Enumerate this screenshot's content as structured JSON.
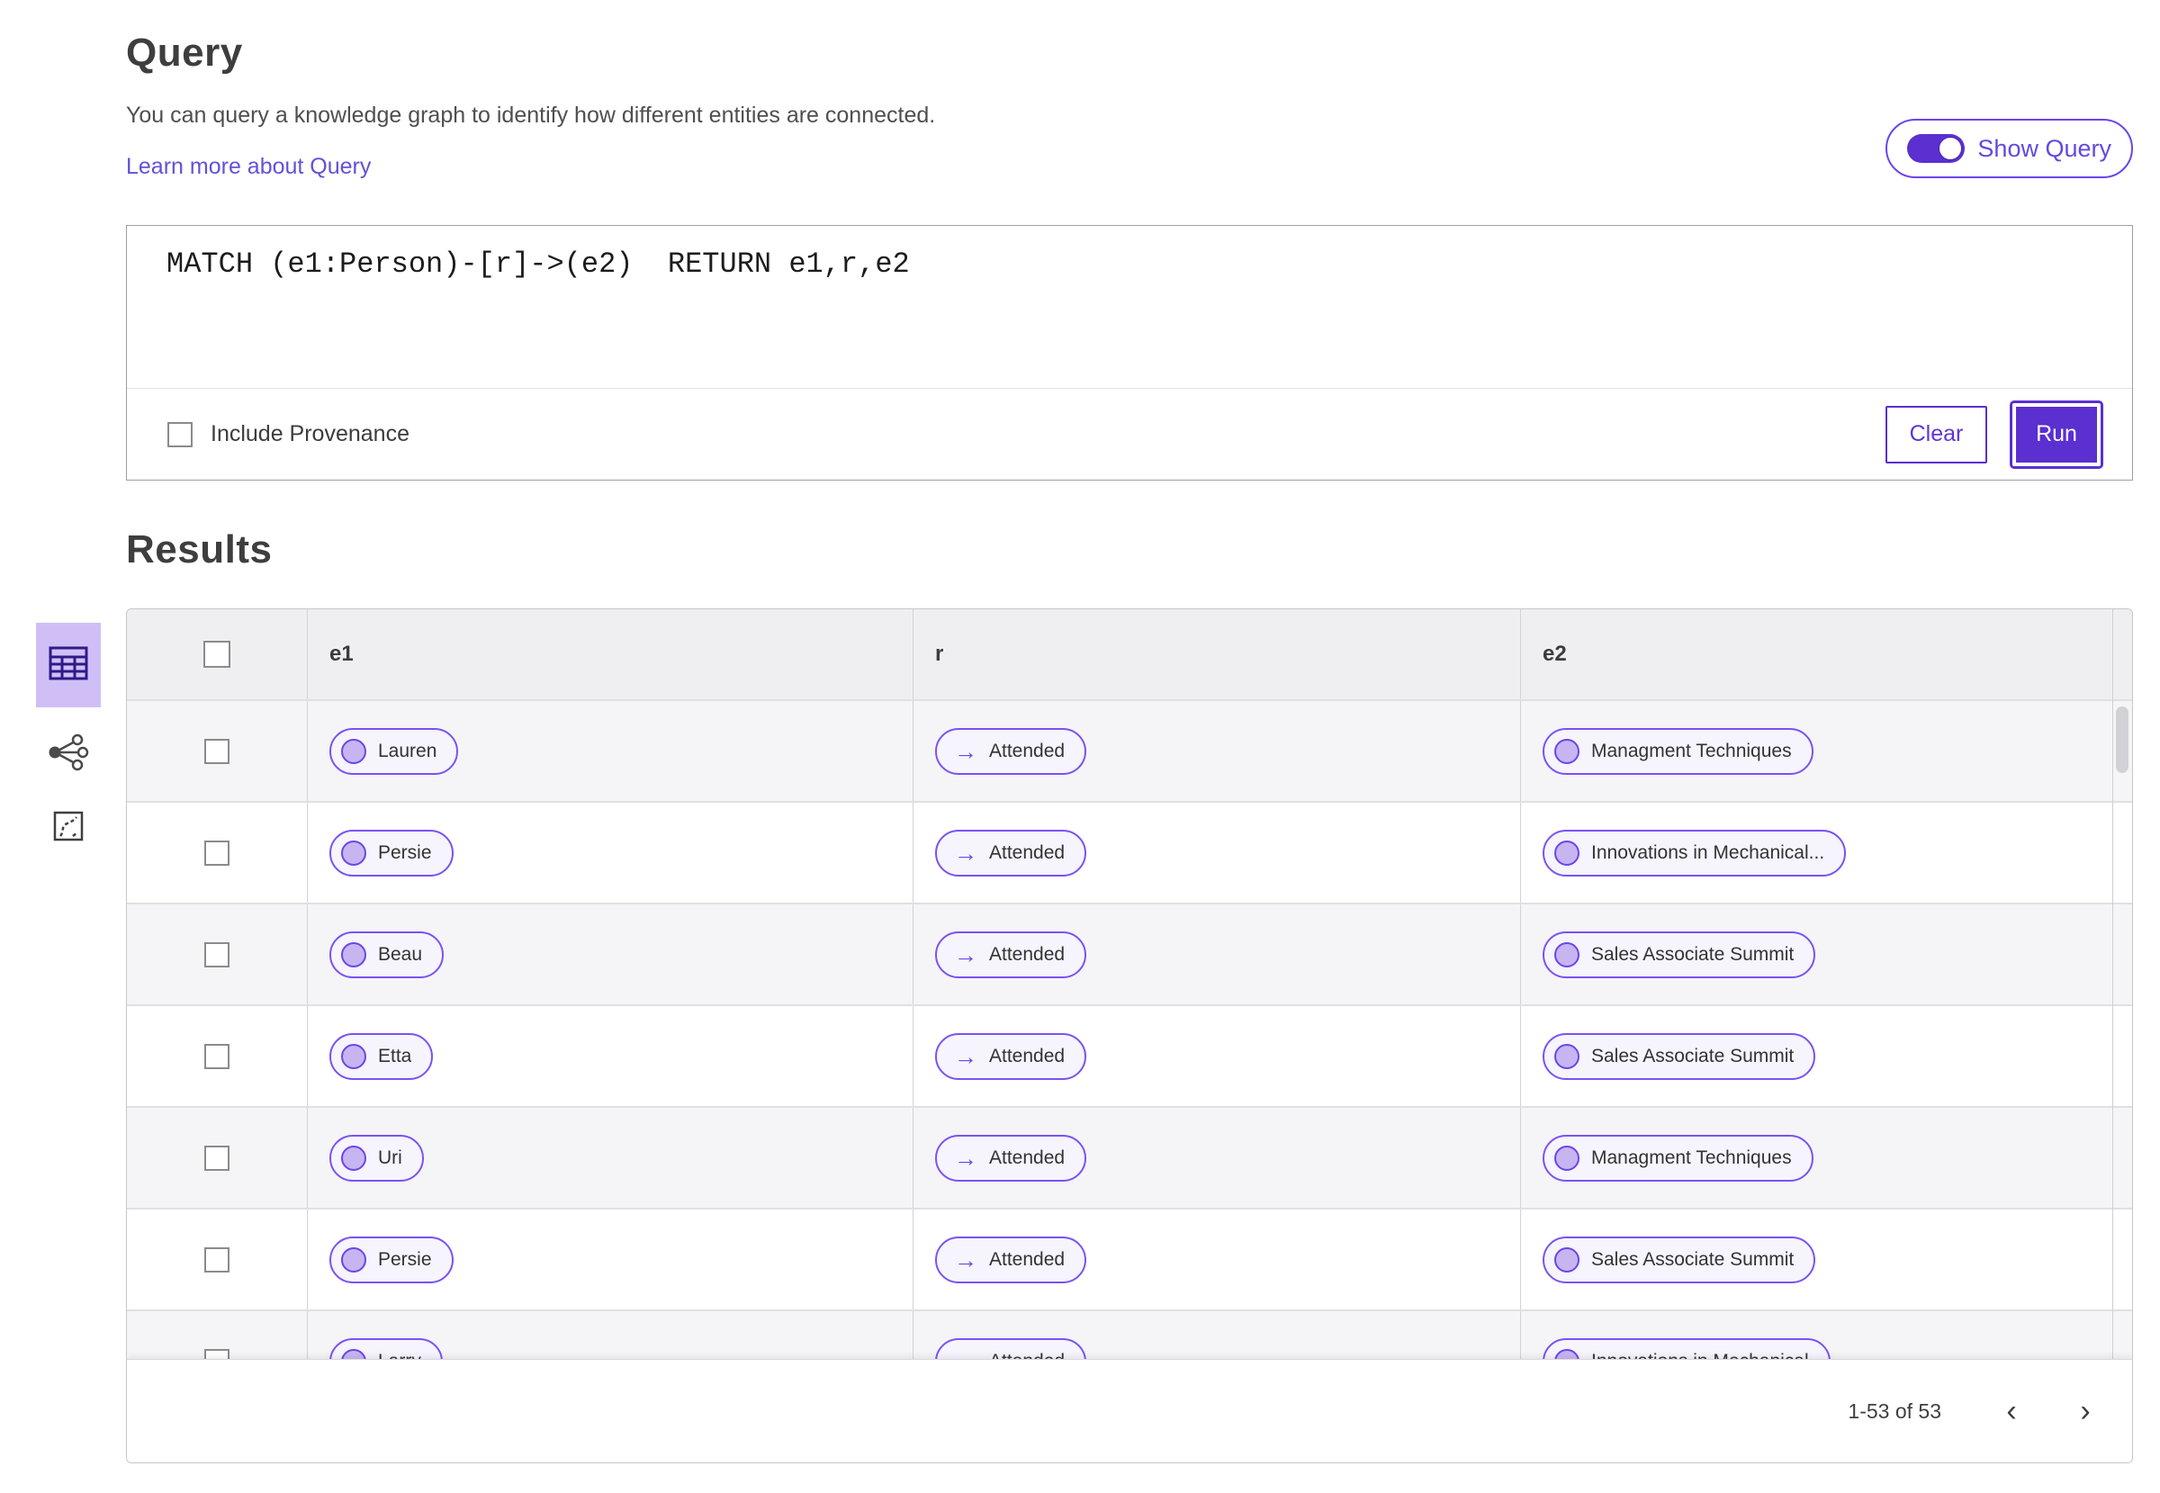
{
  "header": {
    "title": "Query",
    "description": "You can query a knowledge graph to identify how different entities are connected.",
    "learn_more": "Learn more about Query",
    "show_query_label": "Show Query",
    "show_query_on": true
  },
  "query_panel": {
    "query_text": "MATCH (e1:Person)-[r]->(e2)  RETURN e1,r,e2",
    "include_provenance_label": "Include Provenance",
    "include_provenance_checked": false,
    "clear_label": "Clear",
    "run_label": "Run"
  },
  "results": {
    "title": "Results",
    "views": [
      {
        "name": "table-view",
        "icon": "table-icon",
        "selected": true
      },
      {
        "name": "graph-view",
        "icon": "network-icon",
        "selected": false
      },
      {
        "name": "path-view",
        "icon": "route-icon",
        "selected": false
      }
    ],
    "columns": [
      "e1",
      "r",
      "e2"
    ],
    "arrow_glyph": "→",
    "rows": [
      {
        "e1": "Lauren",
        "r": "Attended",
        "e2": "Managment Techniques"
      },
      {
        "e1": "Persie",
        "r": "Attended",
        "e2": "Innovations in Mechanical..."
      },
      {
        "e1": "Beau",
        "r": "Attended",
        "e2": "Sales Associate Summit"
      },
      {
        "e1": "Etta",
        "r": "Attended",
        "e2": "Sales Associate Summit"
      },
      {
        "e1": "Uri",
        "r": "Attended",
        "e2": "Managment Techniques"
      },
      {
        "e1": "Persie",
        "r": "Attended",
        "e2": "Sales Associate Summit"
      },
      {
        "e1": "Larry",
        "r": "Attended",
        "e2": "Innovations in Mechanical"
      }
    ],
    "pagination": {
      "range_label": "1-53 of 53",
      "prev_glyph": "‹",
      "next_glyph": "›"
    }
  },
  "colors": {
    "accent": "#5b2fd0",
    "pill_border": "#7a52f4",
    "pill_bg": "#f6f4fd",
    "pill_circle": "#c7b5f2",
    "selected_view_bg": "#d0bff7",
    "link": "#6152d9",
    "header_row_bg": "#efeef0",
    "shade_row_bg": "#f5f4f6"
  }
}
